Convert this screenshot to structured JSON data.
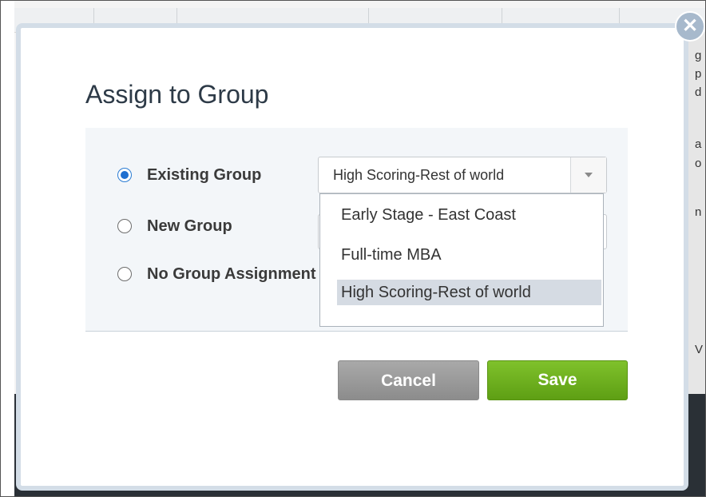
{
  "dialog": {
    "title": "Assign to Group",
    "close_icon": "close-icon",
    "close_glyph": "✕"
  },
  "options": {
    "existing_group_label": "Existing Group",
    "new_group_label": "New Group",
    "no_group_label": "No Group Assignment",
    "selected": "existing_group"
  },
  "group_select": {
    "value": "High Scoring-Rest of world",
    "arrow_icon": "chevron-down-icon"
  },
  "dropdown": {
    "items": [
      "Early Stage - East Coast",
      "Full-time MBA",
      "High Scoring-Rest of world"
    ],
    "highlighted_index": 2
  },
  "buttons": {
    "cancel_label": "Cancel",
    "save_label": "Save"
  },
  "background": {
    "fragments": [
      "g",
      "p",
      "d",
      "a",
      "o",
      "n",
      "V"
    ]
  },
  "colors": {
    "save": "#6aae1d",
    "cancel": "#9b9b9b",
    "radio_selected": "#1f6fd0",
    "modal_border": "#d3dde7"
  }
}
